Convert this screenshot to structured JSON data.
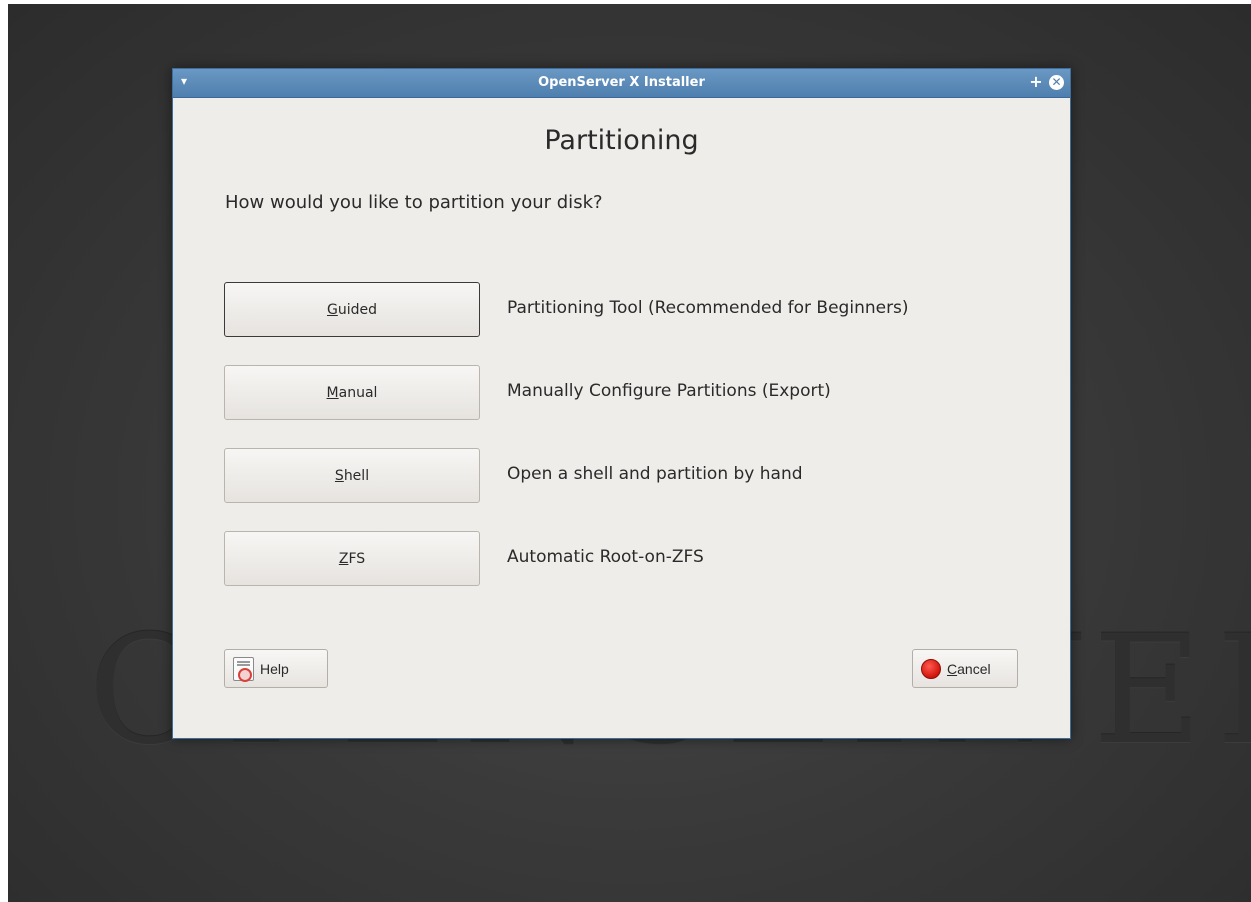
{
  "desktop": {
    "watermark": "OPENSERVER X"
  },
  "window": {
    "title": "OpenServer X Installer",
    "heading": "Partitioning",
    "question": "How would you like to partition your disk?",
    "options": [
      {
        "mnemonic": "G",
        "label_rest": "uided",
        "description": "Partitioning Tool (Recommended for Beginners)"
      },
      {
        "mnemonic": "M",
        "label_rest": "anual",
        "description": "Manually Configure Partitions (Export)"
      },
      {
        "mnemonic": "S",
        "label_rest": "hell",
        "description": "Open a shell and partition by hand"
      },
      {
        "mnemonic": "Z",
        "label_rest": "FS",
        "description": "Automatic Root-on-ZFS"
      }
    ],
    "help_label": "Help",
    "cancel_mnemonic": "C",
    "cancel_rest": "ancel"
  },
  "colors": {
    "titlebar": "#5b8bb9",
    "window_bg": "#efedea",
    "desktop_bg": "#3a3a3a",
    "cancel_icon": "#d0150b"
  },
  "icons": {
    "window_menu": "window-menu-icon",
    "maximize": "plus-icon",
    "close": "close-icon",
    "help": "help-book-icon",
    "cancel": "stop-icon"
  }
}
